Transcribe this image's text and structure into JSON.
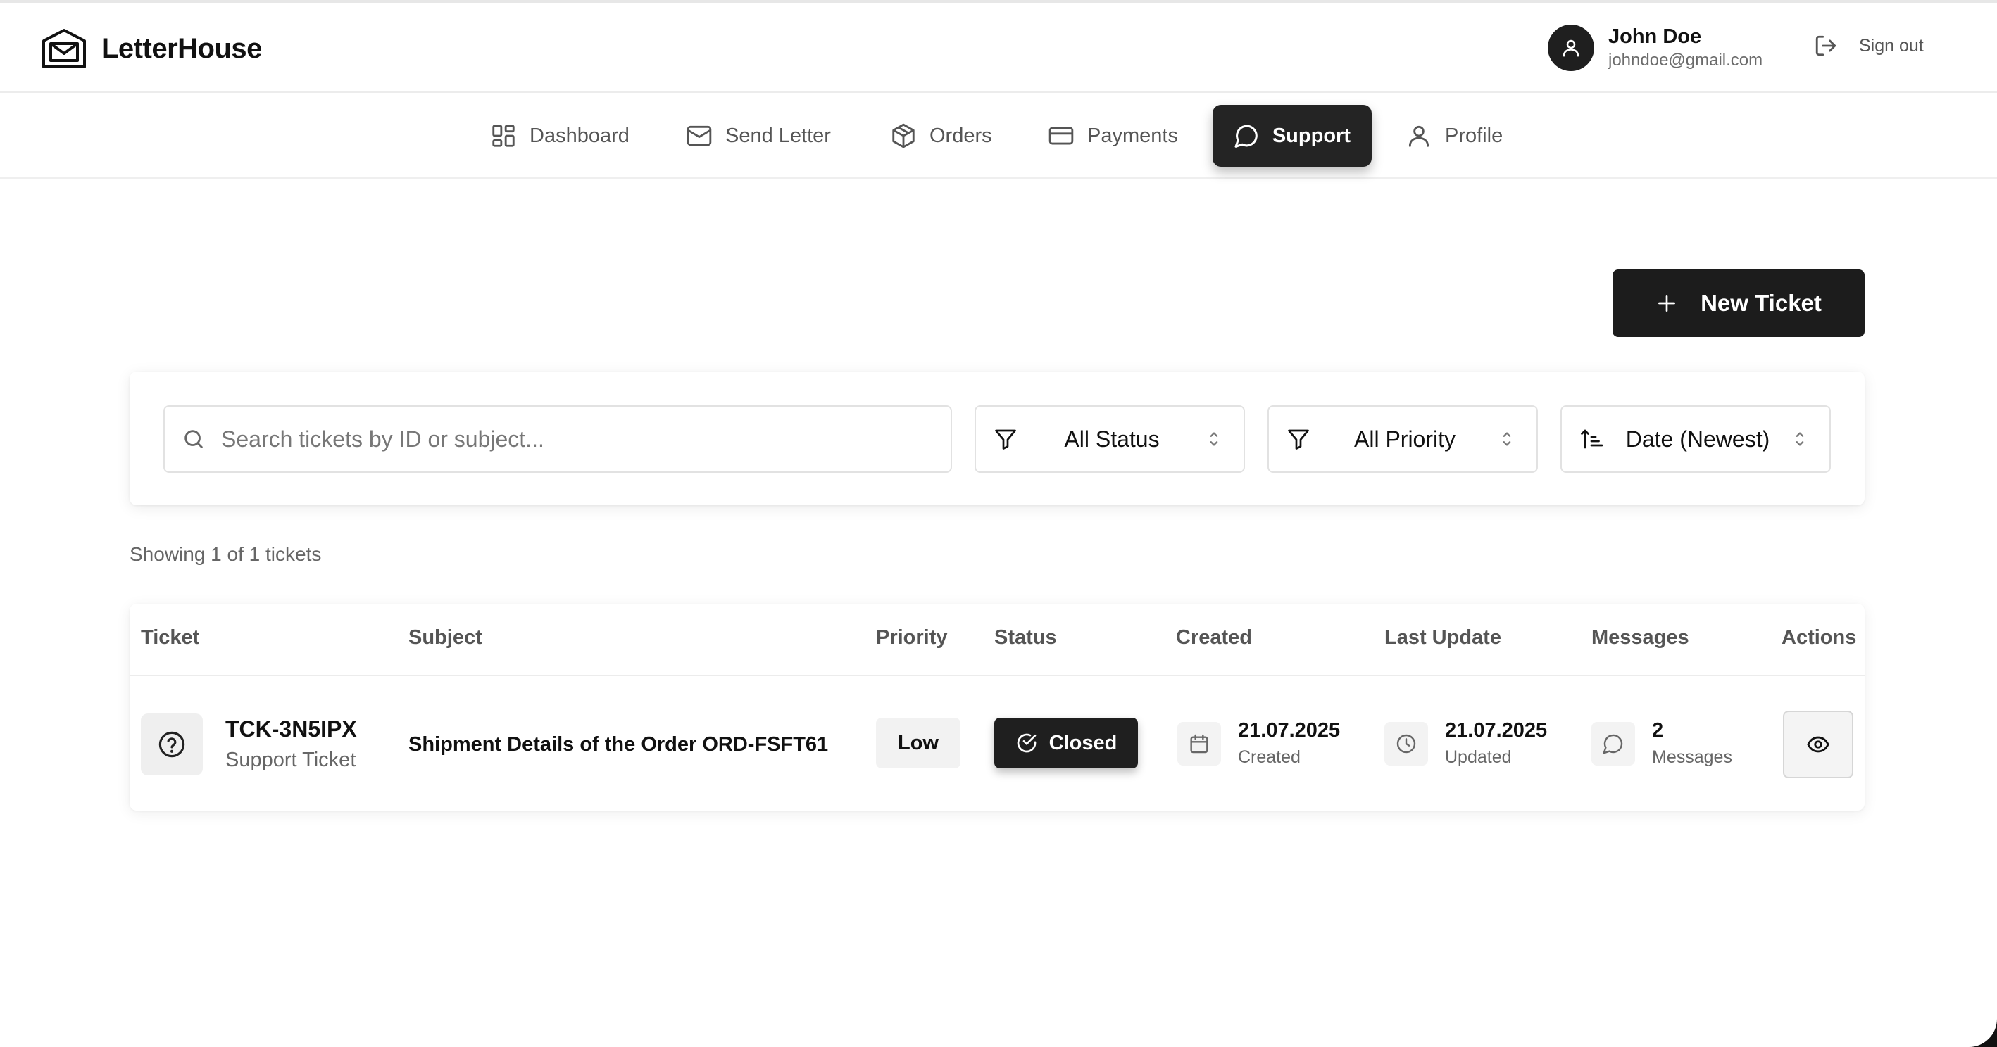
{
  "app": {
    "name": "LetterHouse"
  },
  "user": {
    "name": "John Doe",
    "email": "johndoe@gmail.com",
    "signout_label": "Sign out"
  },
  "nav": {
    "items": [
      {
        "label": "Dashboard",
        "icon": "dashboard-icon"
      },
      {
        "label": "Send Letter",
        "icon": "mail-icon"
      },
      {
        "label": "Orders",
        "icon": "box-icon"
      },
      {
        "label": "Payments",
        "icon": "card-icon"
      },
      {
        "label": "Support",
        "icon": "chat-icon",
        "active": true
      },
      {
        "label": "Profile",
        "icon": "user-icon"
      }
    ]
  },
  "actions": {
    "new_ticket_label": "New Ticket"
  },
  "filters": {
    "search_placeholder": "Search tickets by ID or subject...",
    "search_value": "",
    "status": "All Status",
    "priority": "All Priority",
    "sort": "Date (Newest)"
  },
  "summary": "Showing 1 of 1 tickets",
  "table": {
    "headers": [
      "Ticket",
      "Subject",
      "Priority",
      "Status",
      "Created",
      "Last Update",
      "Messages",
      "Actions"
    ],
    "rows": [
      {
        "id": "TCK-3N5IPX",
        "type": "Support Ticket",
        "subject": "Shipment Details of the Order ORD-FSFT61",
        "priority": "Low",
        "status": "Closed",
        "created": "21.07.2025",
        "created_label": "Created",
        "updated": "21.07.2025",
        "updated_label": "Updated",
        "messages": "2",
        "messages_label": "Messages"
      }
    ]
  },
  "colors": {
    "primary": "#1c1c1c",
    "muted_text": "#666666",
    "border": "#e2e2e2"
  }
}
